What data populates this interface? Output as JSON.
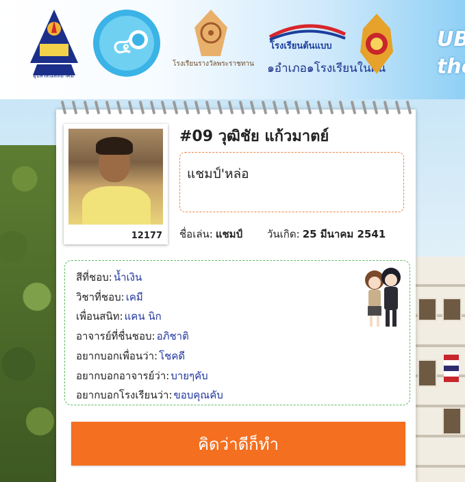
{
  "header": {
    "banner_line1": "UB",
    "banner_line2": "the",
    "logos": [
      {
        "icon": "school-emblem-icon",
        "caption": "อุบลรัตน์พิทยาคม"
      },
      {
        "icon": "anniversary-emblem-icon"
      },
      {
        "icon": "dharma-wheel-emblem-icon",
        "caption": "โรงเรียนรางวัลพระราชทาน"
      },
      {
        "icon": "model-school-logo-icon",
        "title": "โรงเรียนต้นแบบ",
        "subtitle": "๑อำเภอ๑โรงเรียนในฝัน"
      },
      {
        "icon": "ministry-emblem-icon"
      }
    ]
  },
  "profile": {
    "student_no": "12177",
    "name": "#09 วุฒิชัย แก้วมาตย์",
    "quote": "แชมป์'หล่อ",
    "nickname_label": "ชื่อเล่น:",
    "nickname": "แชมป์",
    "birthday_label": "วันเกิด:",
    "birthday": "25 มีนาคม 2541"
  },
  "favorites": [
    {
      "label": "สีที่ชอบ:",
      "value": "น้ำเงิน"
    },
    {
      "label": "วิชาที่ชอบ:",
      "value": "เคมี"
    },
    {
      "label": "เพื่อนสนิท:",
      "value": "แคน นิก"
    },
    {
      "label": "อาจารย์ที่ชื่นชอบ:",
      "value": "อภิชาติ"
    },
    {
      "label": "อยากบอกเพื่อนว่า:",
      "value": "โชคดี"
    },
    {
      "label": "อยากบอกอาจารย์ว่า:",
      "value": "บายๆคับ"
    },
    {
      "label": "อยากบอกโรงเรียนว่า:",
      "value": "ขอบคุณคับ"
    }
  ],
  "motto": "คิดว่าดีก็ทำ",
  "colors": {
    "accent_orange": "#f46f1f",
    "value_blue": "#1f35a0",
    "dash_green": "#5cb85c",
    "dash_orange": "#f08040"
  }
}
